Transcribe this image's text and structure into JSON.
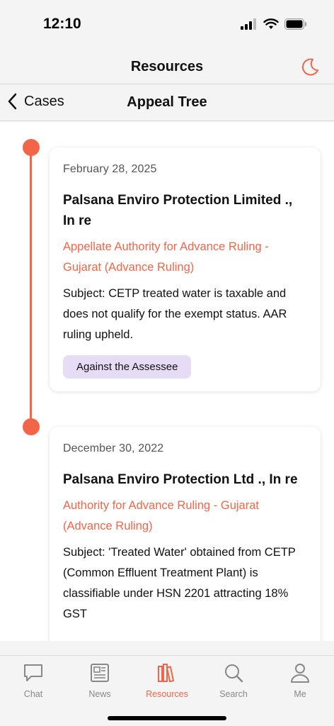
{
  "status_bar": {
    "time": "12:10"
  },
  "header": {
    "title": "Resources",
    "theme_icon": "moon-icon"
  },
  "sub_header": {
    "back_label": "Cases",
    "title": "Appeal Tree"
  },
  "colors": {
    "accent": "#f26548",
    "badge_bg": "#e6dcf5"
  },
  "timeline": [
    {
      "date": "February 28, 2025",
      "title": "Palsana Enviro Protection Limited ., In re",
      "authority": "Appellate Authority for Advance Ruling - Gujarat (Advance Ruling)",
      "subject": "Subject: CETP treated water is taxable and does not qualify for the exempt status. AAR ruling upheld.",
      "badge": "Against the Assessee"
    },
    {
      "date": "December 30, 2022",
      "title": "Palsana Enviro Protection Ltd ., In re",
      "authority": "Authority for Advance Ruling - Gujarat (Advance Ruling)",
      "subject": "Subject: 'Treated Water' obtained from CETP (Common Effluent Treatment Plant) is classifiable under HSN 2201 attracting 18% GST"
    }
  ],
  "tab_bar": {
    "items": [
      {
        "label": "Chat",
        "icon": "chat-icon"
      },
      {
        "label": "News",
        "icon": "news-icon"
      },
      {
        "label": "Resources",
        "icon": "books-icon",
        "active": true
      },
      {
        "label": "Search",
        "icon": "search-icon"
      },
      {
        "label": "Me",
        "icon": "person-icon"
      }
    ]
  }
}
